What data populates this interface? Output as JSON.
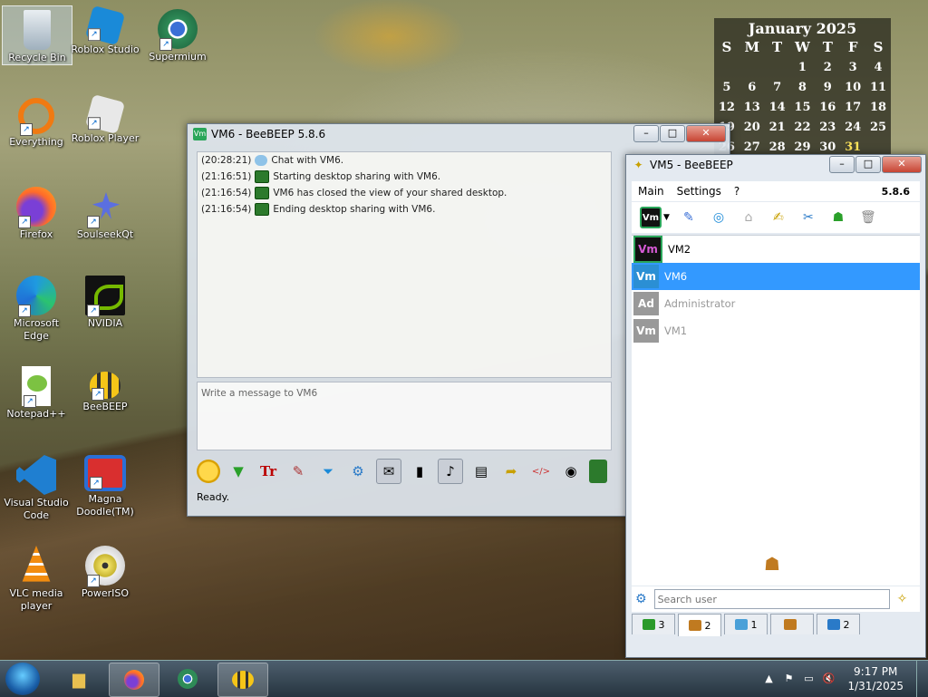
{
  "desktop": {
    "icons": [
      {
        "label": "Recycle Bin"
      },
      {
        "label": "Roblox Studio"
      },
      {
        "label": "Supermium"
      },
      {
        "label": "Everything"
      },
      {
        "label": "Roblox Player"
      },
      {
        "label": "Firefox"
      },
      {
        "label": "SoulseekQt"
      },
      {
        "label": "Microsoft Edge"
      },
      {
        "label": "NVIDIA"
      },
      {
        "label": "Notepad++"
      },
      {
        "label": "BeeBEEP"
      },
      {
        "label": "Visual Studio Code"
      },
      {
        "label": "Magna Doodle(TM)"
      },
      {
        "label": "VLC media player"
      },
      {
        "label": "PowerISO"
      }
    ]
  },
  "calendar": {
    "title": "January 2025",
    "weekdays": [
      "S",
      "M",
      "T",
      "W",
      "T",
      "F",
      "S"
    ],
    "weeks": [
      [
        "",
        "",
        "",
        "1",
        "2",
        "3",
        "4"
      ],
      [
        "5",
        "6",
        "7",
        "8",
        "9",
        "10",
        "11"
      ],
      [
        "12",
        "13",
        "14",
        "15",
        "16",
        "17",
        "18"
      ],
      [
        "19",
        "20",
        "21",
        "22",
        "23",
        "24",
        "25"
      ],
      [
        "26",
        "27",
        "28",
        "29",
        "30",
        "31",
        ""
      ]
    ],
    "today": "31"
  },
  "chat_window": {
    "title": "VM6 - BeeBEEP 5.8.6",
    "app_icon": "Vm",
    "log": [
      {
        "time": "(20:28:21)",
        "icon": "chat-bubble-icon",
        "text": "Chat with VM6."
      },
      {
        "time": "(21:16:51)",
        "icon": "desktop-share-icon",
        "text": "Starting desktop sharing with VM6."
      },
      {
        "time": "(21:16:54)",
        "icon": "desktop-share-icon",
        "text": "VM6 has closed the view of your shared desktop."
      },
      {
        "time": "(21:16:54)",
        "icon": "desktop-share-icon",
        "text": "Ending desktop sharing with VM6."
      }
    ],
    "message_placeholder": "Write a message to VM6",
    "status": "Ready."
  },
  "main_window": {
    "title": "VM5 - BeeBEEP",
    "menu": [
      "Main",
      "Settings",
      "?"
    ],
    "version": "5.8.6",
    "current_user_avatar": "Vm",
    "users": [
      {
        "avatar": "Vm",
        "name": "VM2",
        "state": "online"
      },
      {
        "avatar": "Vm",
        "name": "VM6",
        "state": "selected"
      },
      {
        "avatar": "Ad",
        "name": "Administrator",
        "state": "offline"
      },
      {
        "avatar": "Vm",
        "name": "VM1",
        "state": "offline"
      }
    ],
    "search_placeholder": "Search user",
    "tabs": [
      {
        "icon": "green-screen-icon",
        "count": "3"
      },
      {
        "icon": "users-icon",
        "count": "2"
      },
      {
        "icon": "chats-icon",
        "count": "1"
      },
      {
        "icon": "groups-icon",
        "count": ""
      },
      {
        "icon": "shares-icon",
        "count": "2"
      }
    ]
  },
  "taskbar": {
    "clock_time": "9:17 PM",
    "clock_date": "1/31/2025"
  },
  "colors": {
    "selection": "#3399ff",
    "avatar_online": "#5a0a5a",
    "avatar_selected": "#2b8fd4",
    "avatar_offline": "#999999",
    "calendar_today": "#ffe55a"
  }
}
